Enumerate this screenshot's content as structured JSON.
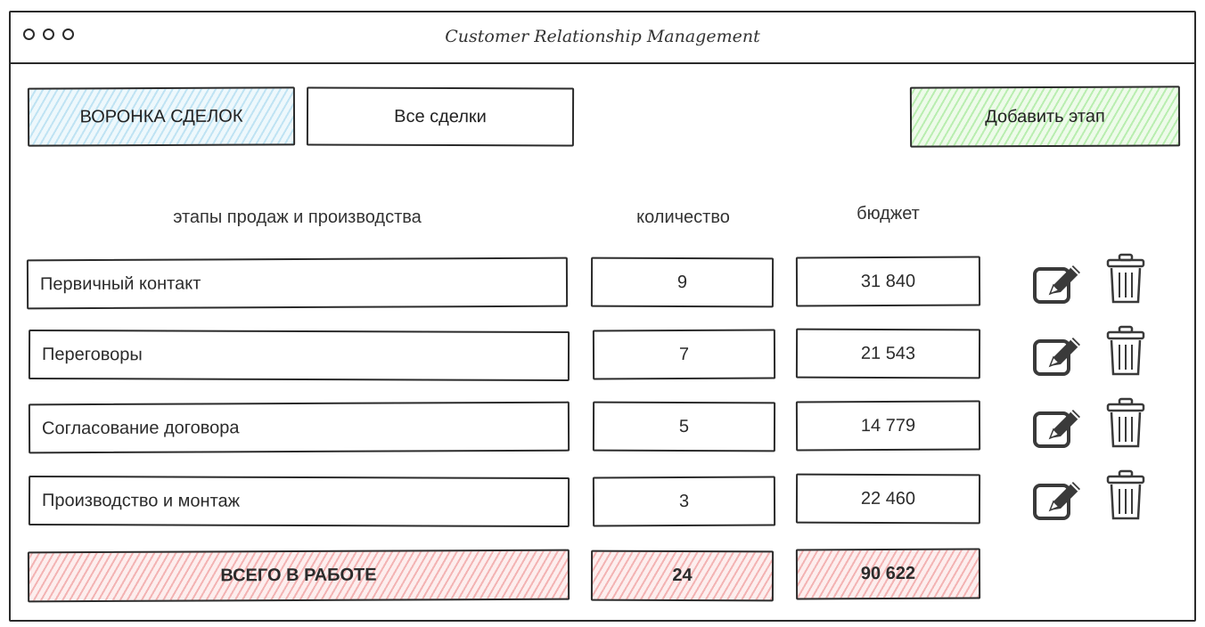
{
  "window": {
    "title": "Customer Relationship Management"
  },
  "toolbar": {
    "tab_funnel": "ВОРОНКА СДЕЛОК",
    "tab_all_deals": "Все сделки",
    "add_stage": "Добавить этап"
  },
  "table": {
    "headers": {
      "stage": "этапы продаж и производства",
      "count": "количество",
      "budget": "бюджет"
    },
    "rows": [
      {
        "stage": "Первичный контакт",
        "count": "9",
        "budget": "31 840"
      },
      {
        "stage": "Переговоры",
        "count": "7",
        "budget": "21 543"
      },
      {
        "stage": "Согласование договора",
        "count": "5",
        "budget": "14 779"
      },
      {
        "stage": "Производство и монтаж",
        "count": "3",
        "budget": "22 460"
      }
    ],
    "total": {
      "label": "ВСЕГО В РАБОТЕ",
      "count": "24",
      "budget": "90 622"
    }
  },
  "icons": {
    "edit": "edit-icon",
    "delete": "trash-icon"
  },
  "colors": {
    "tab_active": "#bfe3f3",
    "add_button": "#b9eeb0",
    "total_row": "#f3b3b3",
    "stroke": "#2b2b2b"
  }
}
